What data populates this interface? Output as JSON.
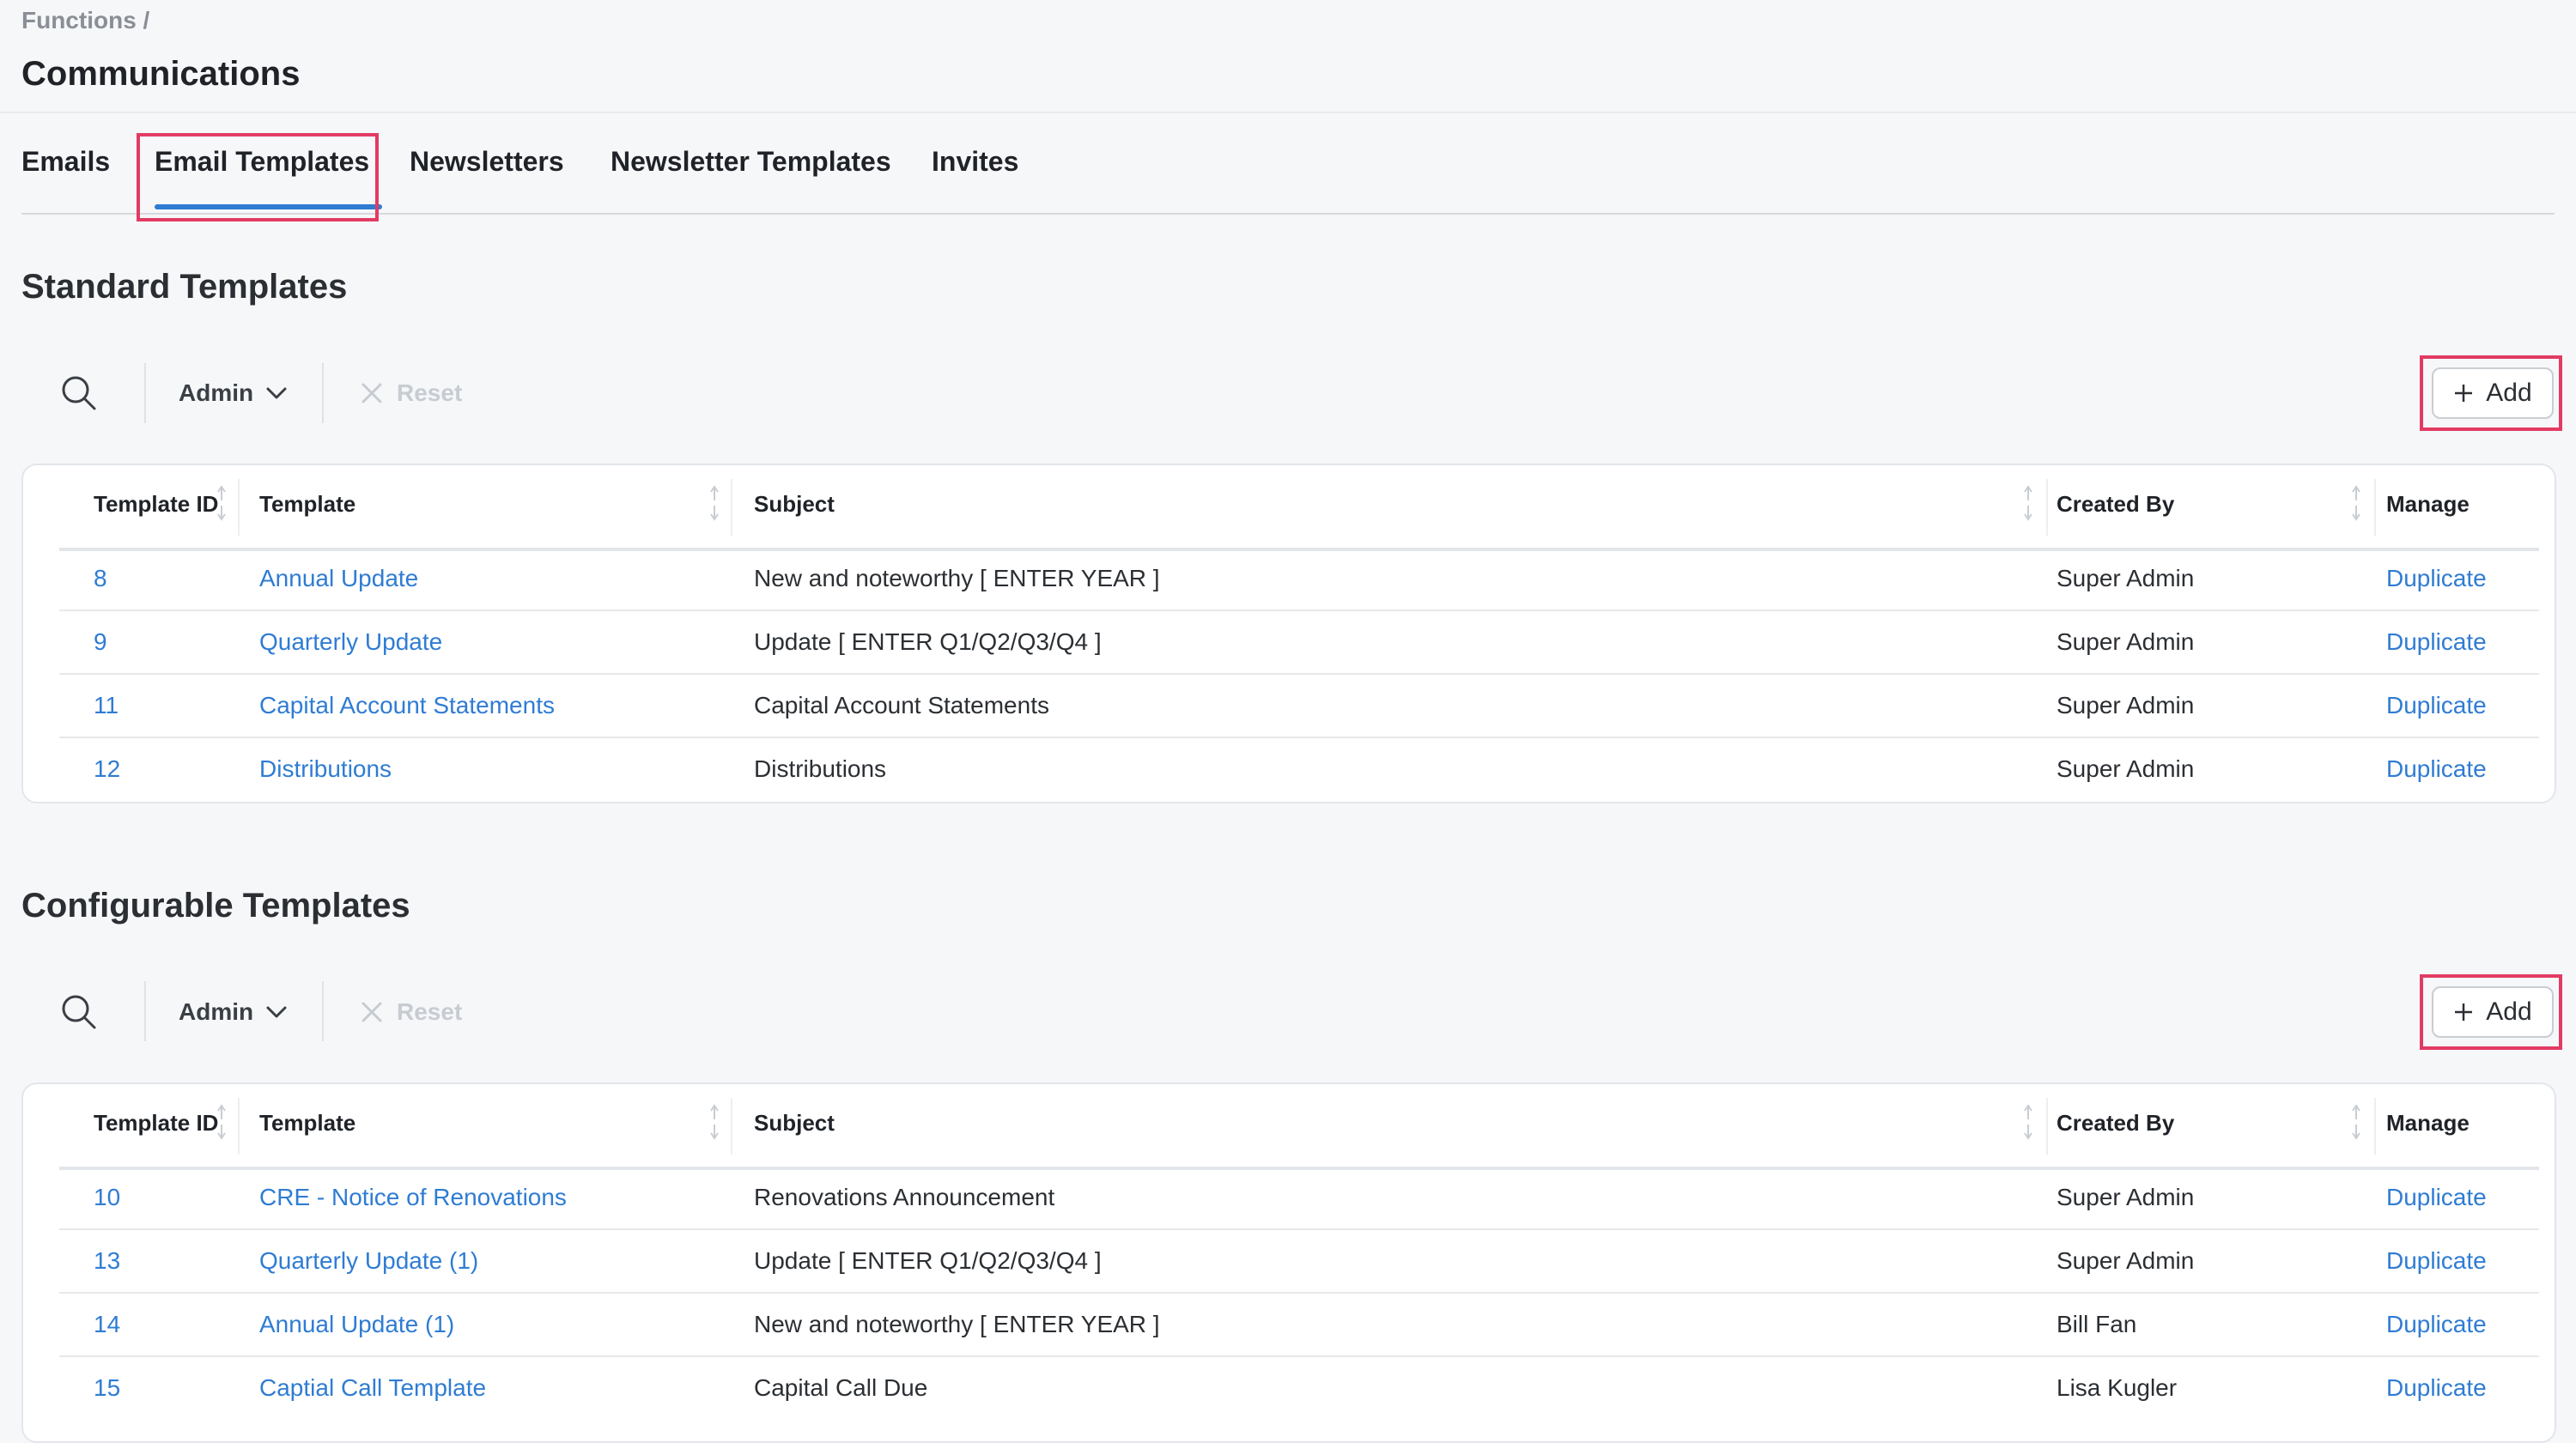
{
  "breadcrumb": "Functions /",
  "page_title": "Communications",
  "tabs": [
    {
      "label": "Emails"
    },
    {
      "label": "Email Templates",
      "active": true
    },
    {
      "label": "Newsletters"
    },
    {
      "label": "Newsletter Templates"
    },
    {
      "label": "Invites"
    }
  ],
  "highlight_color": "#e23b63",
  "accent_color": "#2f7cd3",
  "toolbar": {
    "filter_label": "Admin",
    "reset_label": "Reset",
    "add_label": "Add"
  },
  "columns": [
    "Template ID",
    "Template",
    "Subject",
    "Created By",
    "Manage"
  ],
  "sections": [
    {
      "title": "Standard Templates",
      "rows": [
        {
          "id": "8",
          "template": "Annual Update",
          "subject": "New and noteworthy [ ENTER YEAR ]",
          "created_by": "Super Admin",
          "manage": "Duplicate"
        },
        {
          "id": "9",
          "template": "Quarterly Update",
          "subject": "Update [ ENTER Q1/Q2/Q3/Q4 ]",
          "created_by": "Super Admin",
          "manage": "Duplicate"
        },
        {
          "id": "11",
          "template": "Capital Account Statements",
          "subject": "Capital Account Statements",
          "created_by": "Super Admin",
          "manage": "Duplicate"
        },
        {
          "id": "12",
          "template": "Distributions",
          "subject": "Distributions",
          "created_by": "Super Admin",
          "manage": "Duplicate"
        }
      ]
    },
    {
      "title": "Configurable Templates",
      "rows": [
        {
          "id": "10",
          "template": "CRE - Notice of Renovations",
          "subject": "Renovations Announcement",
          "created_by": "Super Admin",
          "manage": "Duplicate"
        },
        {
          "id": "13",
          "template": "Quarterly Update (1)",
          "subject": "Update [ ENTER Q1/Q2/Q3/Q4 ]",
          "created_by": "Super Admin",
          "manage": "Duplicate"
        },
        {
          "id": "14",
          "template": "Annual Update (1)",
          "subject": "New and noteworthy [ ENTER YEAR ]",
          "created_by": "Bill Fan",
          "manage": "Duplicate"
        },
        {
          "id": "15",
          "template": "Captial Call Template",
          "subject": "Capital Call Due",
          "created_by": "Lisa Kugler",
          "manage": "Duplicate"
        }
      ]
    }
  ]
}
